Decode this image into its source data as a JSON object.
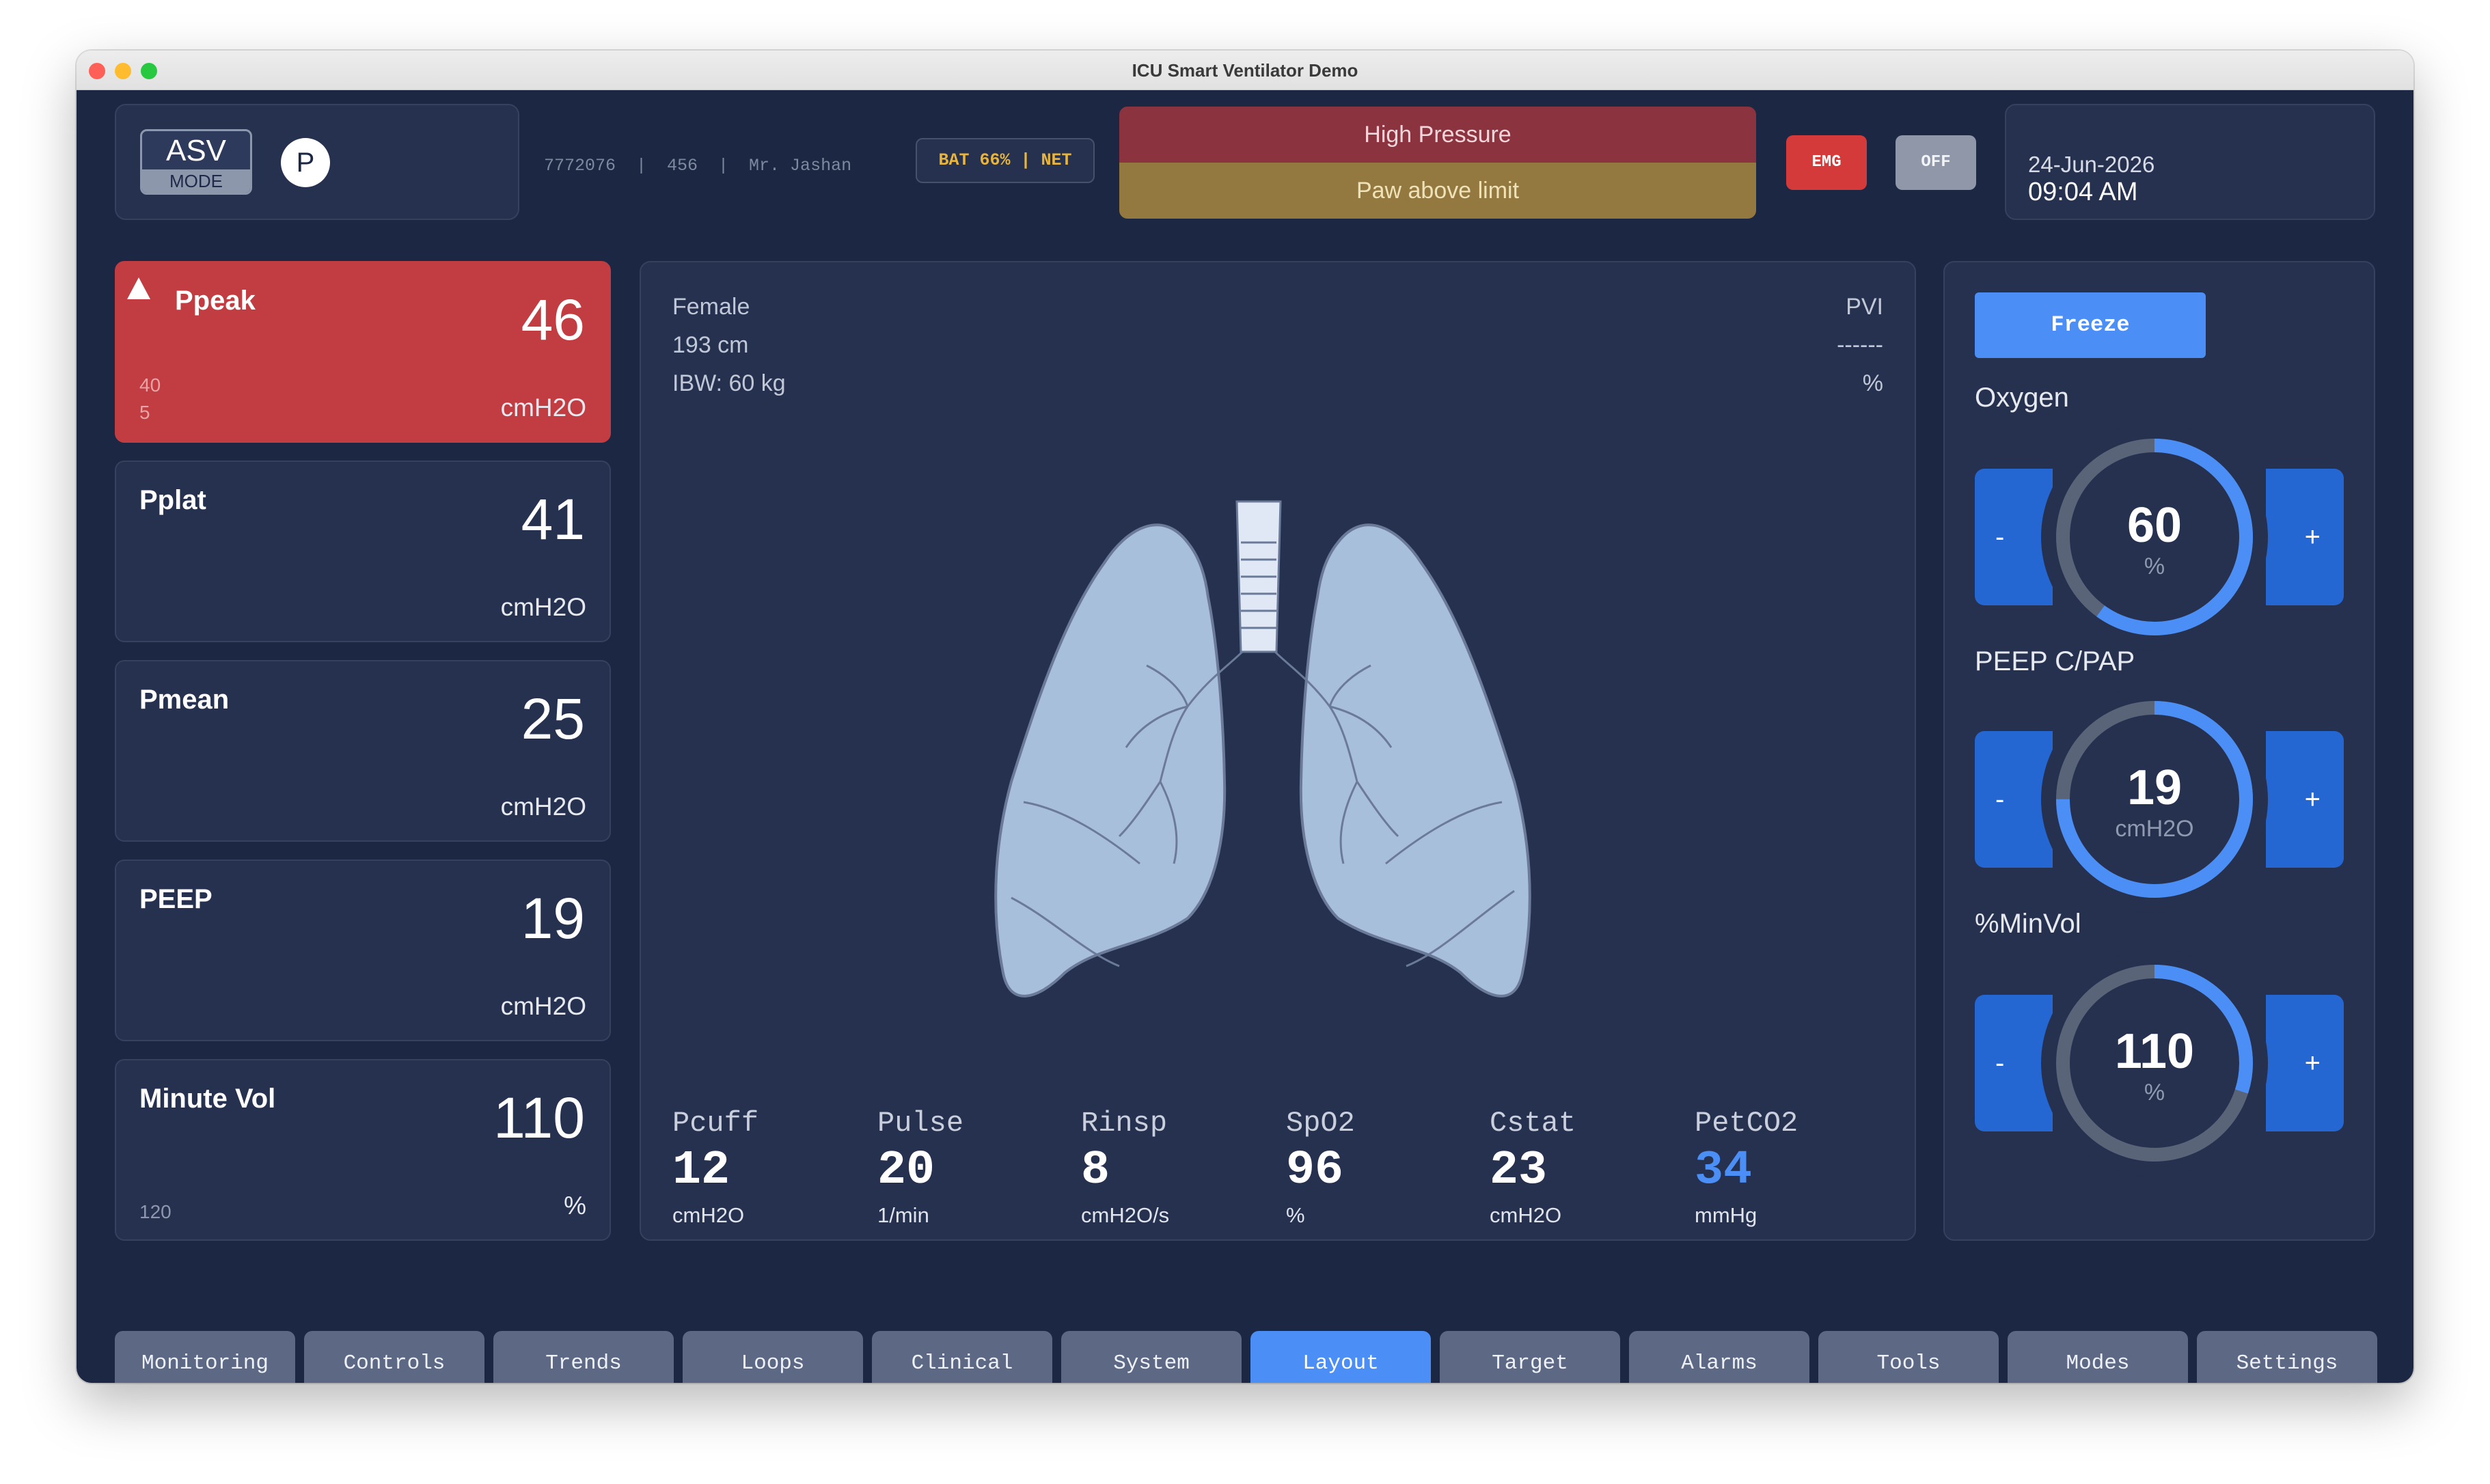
{
  "window": {
    "title": "ICU Smart Ventilator Demo"
  },
  "header": {
    "mode": {
      "name": "ASV",
      "sub": "MODE",
      "indicator": "P"
    },
    "patient_info": "7772076  |  456  |  Mr. Jashan",
    "status_pill": "BAT 66% | NET",
    "alarms": [
      {
        "text": "High Pressure",
        "color": "#8c3340"
      },
      {
        "text": "Paw above limit",
        "color": "#93793f"
      }
    ],
    "emg_label": "EMG",
    "off_label": "OFF",
    "date": "24-Jun-2026",
    "time": "09:04 AM"
  },
  "metrics": [
    {
      "label": "Ppeak",
      "value": "46",
      "unit": "cmH2O",
      "limit_high": "40",
      "limit_low": "5",
      "alarm": true
    },
    {
      "label": "Pplat",
      "value": "41",
      "unit": "cmH2O"
    },
    {
      "label": "Pmean",
      "value": "25",
      "unit": "cmH2O"
    },
    {
      "label": "PEEP",
      "value": "19",
      "unit": "cmH2O"
    },
    {
      "label": "Minute Vol",
      "value": "110",
      "unit": "%",
      "limit_low": "120"
    }
  ],
  "patient": {
    "gender": "Female",
    "height": "193 cm",
    "ibw": "IBW: 60 kg",
    "pvi_label": "PVI",
    "pvi_value": "------",
    "pvi_unit": "%"
  },
  "vitals": [
    {
      "label": "Pcuff",
      "value": "12",
      "unit": "cmH2O"
    },
    {
      "label": "Pulse",
      "value": "20",
      "unit": "1/min"
    },
    {
      "label": "Rinsp",
      "value": "8",
      "unit": "cmH2O/s"
    },
    {
      "label": "SpO2",
      "value": "96",
      "unit": "%"
    },
    {
      "label": "Cstat",
      "value": "23",
      "unit": "cmH2O"
    },
    {
      "label": "PetCO2",
      "value": "34",
      "unit": "mmHg",
      "color": "#4b8ef5"
    }
  ],
  "controls": {
    "freeze_label": "Freeze",
    "items": [
      {
        "title": "Oxygen",
        "value": "60",
        "unit": "%",
        "fraction": 0.6,
        "minus": "-",
        "plus": "+"
      },
      {
        "title": "PEEP C/PAP",
        "value": "19",
        "unit": "cmH2O",
        "fraction": 0.75,
        "minus": "-",
        "plus": "+"
      },
      {
        "title": "%MinVol",
        "value": "110",
        "unit": "%",
        "fraction": 0.3,
        "minus": "-",
        "plus": "+"
      }
    ]
  },
  "colors": {
    "accent": "#4b8ef5",
    "alarm_red": "#c13d41",
    "gauge_track": "#5a6478",
    "background": "#1b2743"
  },
  "nav": [
    {
      "label": "Monitoring",
      "active": false
    },
    {
      "label": "Controls",
      "active": false
    },
    {
      "label": "Trends",
      "active": false
    },
    {
      "label": "Loops",
      "active": false
    },
    {
      "label": "Clinical",
      "active": false
    },
    {
      "label": "System",
      "active": false
    },
    {
      "label": "Layout",
      "active": true
    },
    {
      "label": "Target",
      "active": false
    },
    {
      "label": "Alarms",
      "active": false
    },
    {
      "label": "Tools",
      "active": false
    },
    {
      "label": "Modes",
      "active": false
    },
    {
      "label": "Settings",
      "active": false
    }
  ]
}
